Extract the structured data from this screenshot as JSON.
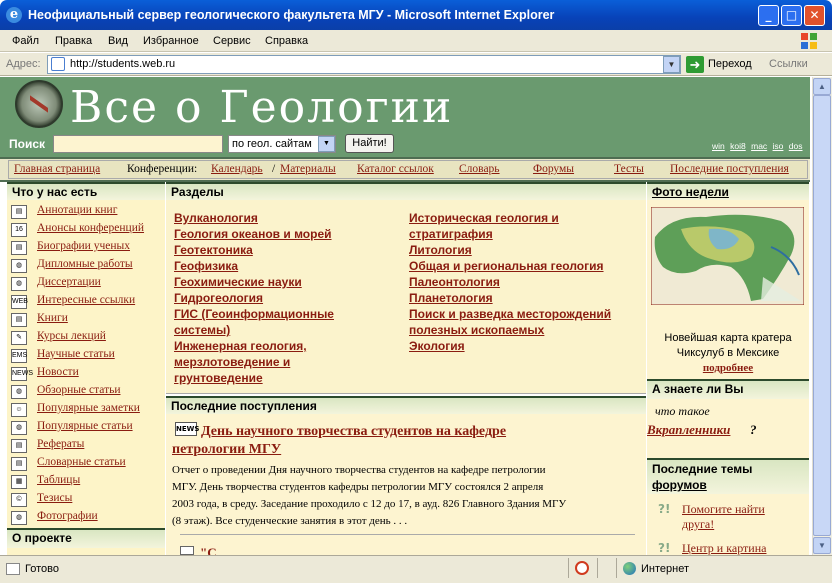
{
  "window": {
    "title": "Неофициальный сервер геологического факультета МГУ - Microsoft Internet Explorer",
    "min": "_",
    "max": "□",
    "close": "✕"
  },
  "menu": [
    "Файл",
    "Правка",
    "Вид",
    "Избранное",
    "Сервис",
    "Справка"
  ],
  "address": {
    "label": "Адрес:",
    "url": "http://students.web.ru",
    "go": "Переход",
    "links": "Ссылки"
  },
  "header": {
    "title": "Все о Геологии",
    "search_label": "Поиск",
    "search_scope": "по геол. сайтам",
    "search_button": "Найти!",
    "encodings": [
      "win",
      "koi8",
      "mac",
      "iso",
      "dos"
    ]
  },
  "nav": {
    "home": "Главная страница",
    "conf_prefix": "Конференции:",
    "calendar": "Календарь",
    "sep": "/",
    "materials": "Материалы",
    "catalog": "Каталог ссылок",
    "dictionary": "Словарь",
    "forums": "Форумы",
    "tests": "Тесты",
    "latest": "Последние поступления"
  },
  "left": {
    "heading": "Что у нас есть",
    "items": [
      {
        "label": "Аннотации книг",
        "icon": "book-icon"
      },
      {
        "label": "Анонсы конференций",
        "icon": "calendar-icon"
      },
      {
        "label": "Биографии ученых",
        "icon": "book-icon"
      },
      {
        "label": "Дипломные работы",
        "icon": "globe-icon"
      },
      {
        "label": "Диссертации",
        "icon": "globe-icon"
      },
      {
        "label": "Интересные ссылки",
        "icon": "web-icon"
      },
      {
        "label": "Книги",
        "icon": "book-icon"
      },
      {
        "label": "Курсы лекций",
        "icon": "lecture-icon"
      },
      {
        "label": "Научные статьи",
        "icon": "ems-icon"
      },
      {
        "label": "Новости",
        "icon": "news-icon"
      },
      {
        "label": "Обзорные статьи",
        "icon": "globe-icon"
      },
      {
        "label": "Популярные заметки",
        "icon": "smile-icon"
      },
      {
        "label": "Популярные статьи",
        "icon": "globe-icon"
      },
      {
        "label": "Рефераты",
        "icon": "book-icon"
      },
      {
        "label": "Словарные статьи",
        "icon": "book-icon"
      },
      {
        "label": "Таблицы",
        "icon": "table-icon"
      },
      {
        "label": "Тезисы",
        "icon": "copyright-icon"
      },
      {
        "label": "Фотографии",
        "icon": "globe-icon"
      }
    ],
    "about": "О проекте"
  },
  "sections": {
    "heading": "Разделы",
    "col1": [
      "Вулканология",
      "Геология океанов и морей",
      "Геотектоника",
      "Геофизика",
      "Геохимические науки",
      "Гидрогеология",
      "ГИС (Геоинформационные",
      "системы)",
      "Инженерная геология,",
      "мерзлотоведение и",
      "грунтоведение"
    ],
    "col2": [
      "Историческая геология и",
      "стратиграфия",
      "Литология",
      "Общая и региональная геология",
      "Палеонтология",
      "Планетология",
      "Поиск и разведка месторождений",
      "полезных ископаемых",
      "Экология"
    ]
  },
  "latest": {
    "heading": "Последние поступления",
    "news_title_1": "День научного творчества студентов на кафедре",
    "news_title_2": "петрологии МГУ",
    "news_text": [
      "Отчет о проведении Дня научного творчества студентов на кафедре петрологии",
      "МГУ. День творчества студентов кафедры петрологии МГУ состоялся 2 апреля",
      "2003 года, в среду. Заседание проходило с 12 до 17, в ауд. 826 Главного Здания МГУ",
      "(8 этаж). Все студенческие занятия в этот день . . ."
    ],
    "next_title": "\"С..."
  },
  "right": {
    "photo_heading": "Фото недели",
    "photo_caption_1": "Новейшая карта кратера",
    "photo_caption_2": "Чиксулуб в Мексике",
    "photo_more": "подробнее",
    "know_heading": "А знаете ли Вы",
    "know_line1": "что такое",
    "know_link": "Вкрапленники",
    "know_q": "?",
    "forum_heading_1": "Последние темы",
    "forum_heading_2": "форумов",
    "forum_items": [
      "Помогите найти",
      "друга!",
      "Центр и картина"
    ]
  },
  "status": {
    "text": "Готово",
    "zone": "Интернет"
  },
  "colors": {
    "header_green": "#6a9a6f",
    "link": "#8a1c10",
    "cream": "#fdf4d0"
  }
}
